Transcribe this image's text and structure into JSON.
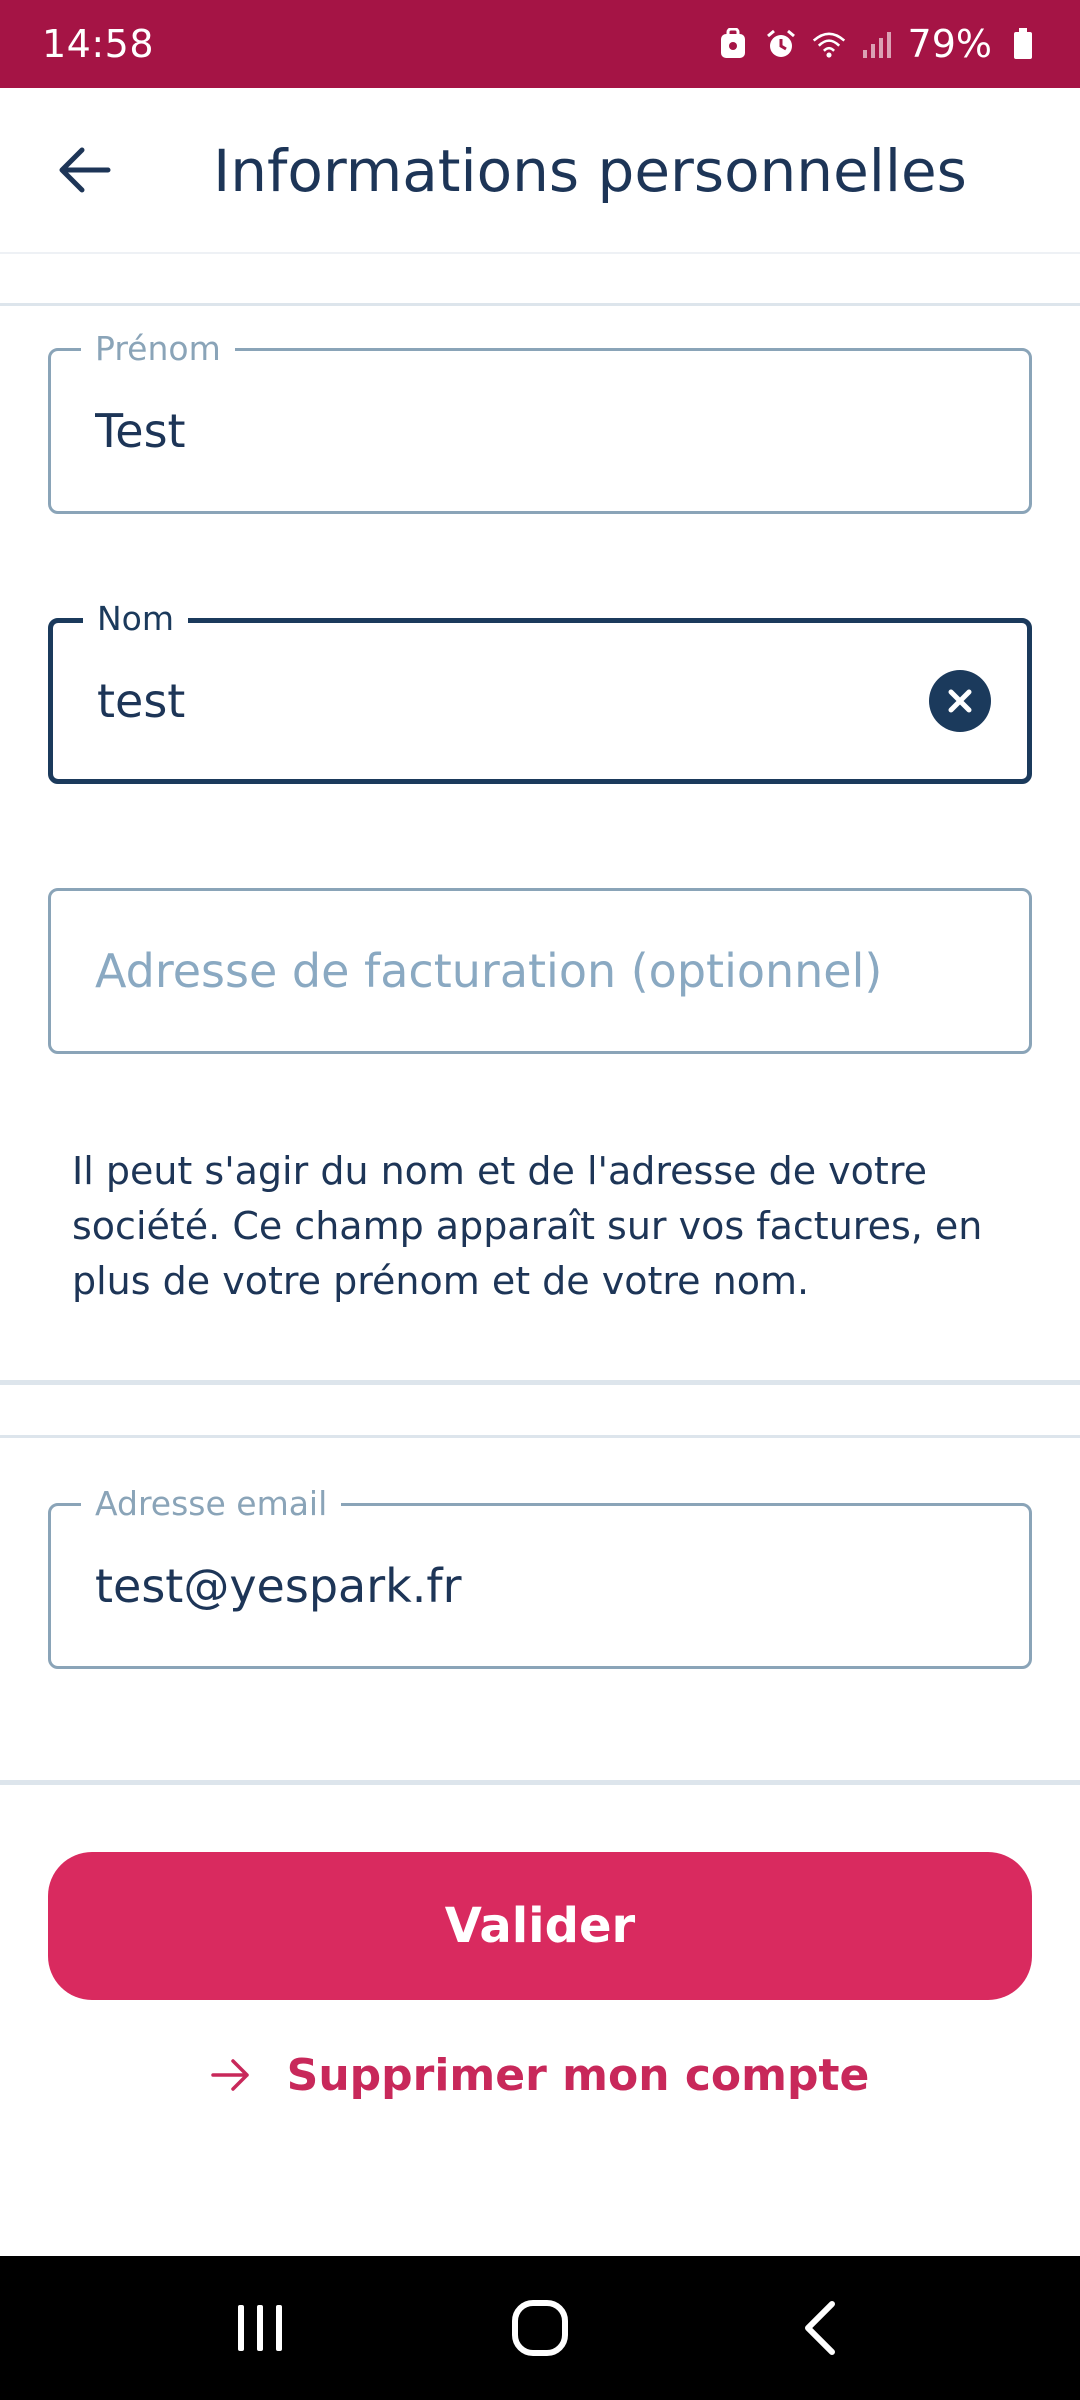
{
  "status_bar": {
    "time": "14:58",
    "battery": "79%",
    "icons": [
      "lock-notification-icon",
      "alarm-icon",
      "wifi-icon",
      "signal-icon",
      "battery-icon"
    ]
  },
  "header": {
    "title": "Informations personnelles",
    "back_icon": "arrow-left-icon"
  },
  "form": {
    "first_name": {
      "label": "Prénom",
      "value": "Test"
    },
    "last_name": {
      "label": "Nom",
      "value": "test"
    },
    "billing_address": {
      "label": "",
      "value": "",
      "placeholder": "Adresse de facturation (optionnel)"
    },
    "helper": "Il peut s'agir du nom et de l'adresse de votre société. Ce champ apparaît sur vos factures, en plus de votre prénom et de votre nom.",
    "email": {
      "label": "Adresse email",
      "value": "test@yespark.fr"
    }
  },
  "actions": {
    "submit_label": "Valider",
    "delete_label": "Supprimer mon compte"
  },
  "colors": {
    "status_bar": "#a51445",
    "accent": "#d92a5f",
    "text": "#1d3557",
    "field_border": "#8aa4b8"
  }
}
